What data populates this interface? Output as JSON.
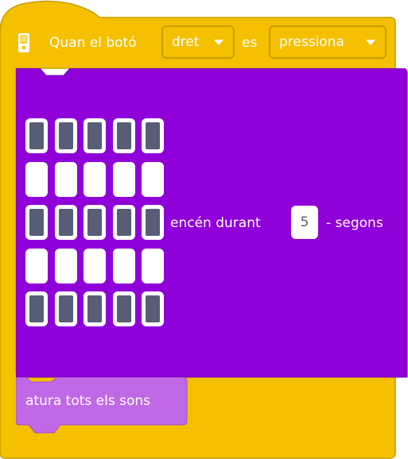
{
  "hat": {
    "prefix": "Quan el botó",
    "button_value": "dret",
    "middle": "es",
    "state_value": "pressiona",
    "icon": "hub-icon"
  },
  "light_block": {
    "grid": [
      [
        1,
        1,
        1,
        1,
        1
      ],
      [
        0,
        0,
        0,
        0,
        0
      ],
      [
        1,
        1,
        1,
        1,
        1
      ],
      [
        0,
        0,
        0,
        0,
        0
      ],
      [
        1,
        1,
        1,
        1,
        1
      ]
    ],
    "label_before": "encén durant",
    "seconds_value": "5",
    "label_after": "- segons"
  },
  "stop_block": {
    "label": "atura tots els sons"
  },
  "colors": {
    "events_fill": "#f4c000",
    "events_border": "#c79d00",
    "light_fill": "#9000d8",
    "light_border": "#7a00b8",
    "sound_fill": "#c069e6",
    "sound_border": "#a24fc9",
    "led_on": "#575e75",
    "led_off": "#ffffff"
  }
}
